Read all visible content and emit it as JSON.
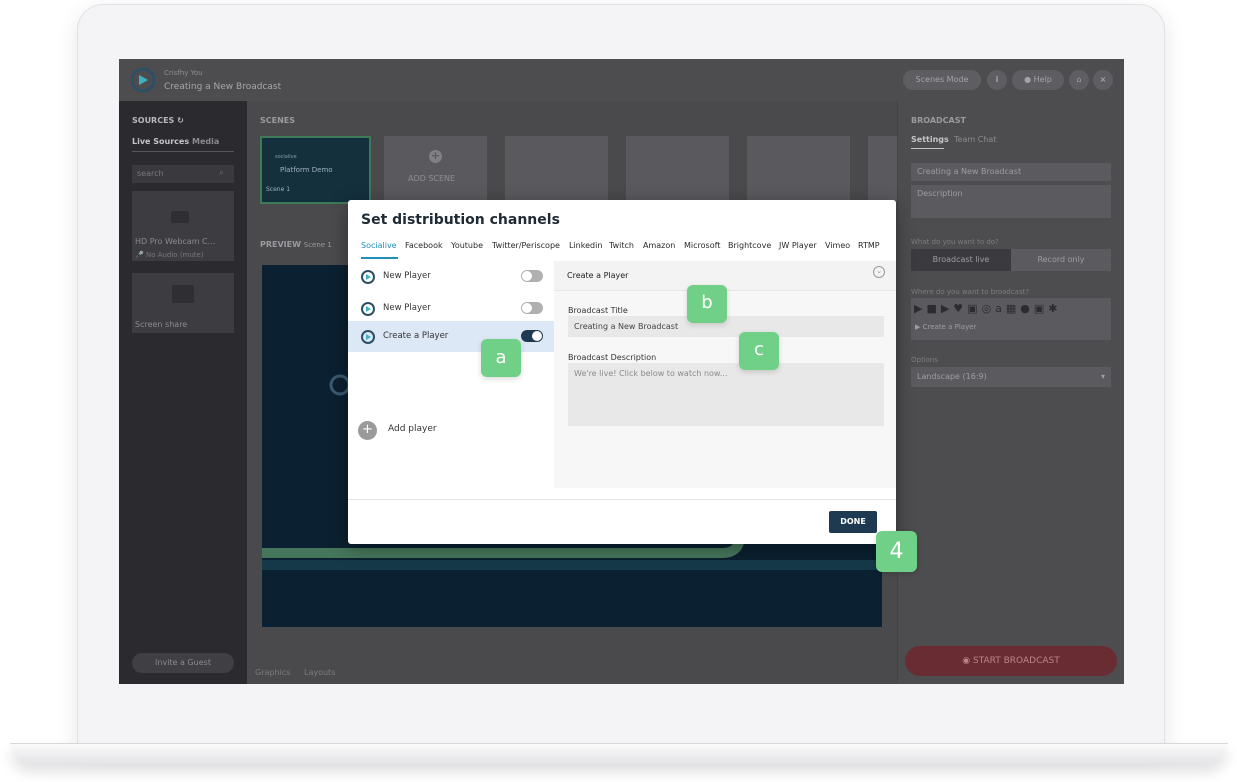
{
  "app": {
    "user_name": "Crisfhy You",
    "broadcast_title": "Creating a New Broadcast",
    "topbar": {
      "scenes_mode": "Scenes Mode",
      "info": "i",
      "help": "Help",
      "close": "×"
    }
  },
  "sources": {
    "heading": "SOURCES",
    "tabs": [
      "Live Sources",
      "Media"
    ],
    "search_placeholder": "search",
    "webcam_label": "HD Pro Webcam C...",
    "audio_label": "No Audio (mute)",
    "screen_share_label": "Screen share",
    "invite_guest": "Invite a Guest"
  },
  "scenes": {
    "heading": "SCENES",
    "scene1_brand": "socialive",
    "scene1_title": "Platform Demo",
    "scene1_name": "Scene 1",
    "add_scene": "ADD SCENE"
  },
  "preview": {
    "label": "PREVIEW",
    "scene": "Scene 1",
    "bottom_tabs": [
      "Graphics",
      "Layouts"
    ]
  },
  "right_panel": {
    "heading": "BROADCAST",
    "tabs": [
      "Settings",
      "Team Chat"
    ],
    "title_value": "Creating a New Broadcast",
    "description_placeholder": "Description",
    "what_label": "What do you want to do?",
    "mode_options": [
      "Broadcast live",
      "Record only"
    ],
    "where_label": "Where do you want to broadcast?",
    "player_tag": "Create a Player",
    "options_label": "Options",
    "orientation": "Landscape (16:9)",
    "start_button": "START BROADCAST"
  },
  "modal": {
    "title": "Set distribution channels",
    "tabs": [
      "Socialive",
      "Facebook",
      "Youtube",
      "Twitter/Periscope",
      "Linkedin",
      "Twitch",
      "Amazon",
      "Microsoft",
      "Brightcove",
      "JW Player",
      "Vimeo",
      "RTMP"
    ],
    "active_tab": "Socialive",
    "players": [
      {
        "label": "New Player",
        "enabled": false
      },
      {
        "label": "New Player",
        "enabled": false
      },
      {
        "label": "Create a Player",
        "enabled": true
      }
    ],
    "add_player": "Add player",
    "form_header": "Create a Player",
    "title_label": "Broadcast Title",
    "title_value": "Creating a New Broadcast",
    "description_label": "Broadcast Description",
    "description_placeholder": "We're live! Click below to watch now...",
    "done_button": "DONE"
  },
  "callouts": {
    "a": "a",
    "b": "b",
    "c": "c",
    "step": "4"
  },
  "colors": {
    "accent": "#1f8fb8",
    "dark_navy": "#1d3a52",
    "callout_green": "#71d088",
    "start_red": "#c0283a"
  }
}
